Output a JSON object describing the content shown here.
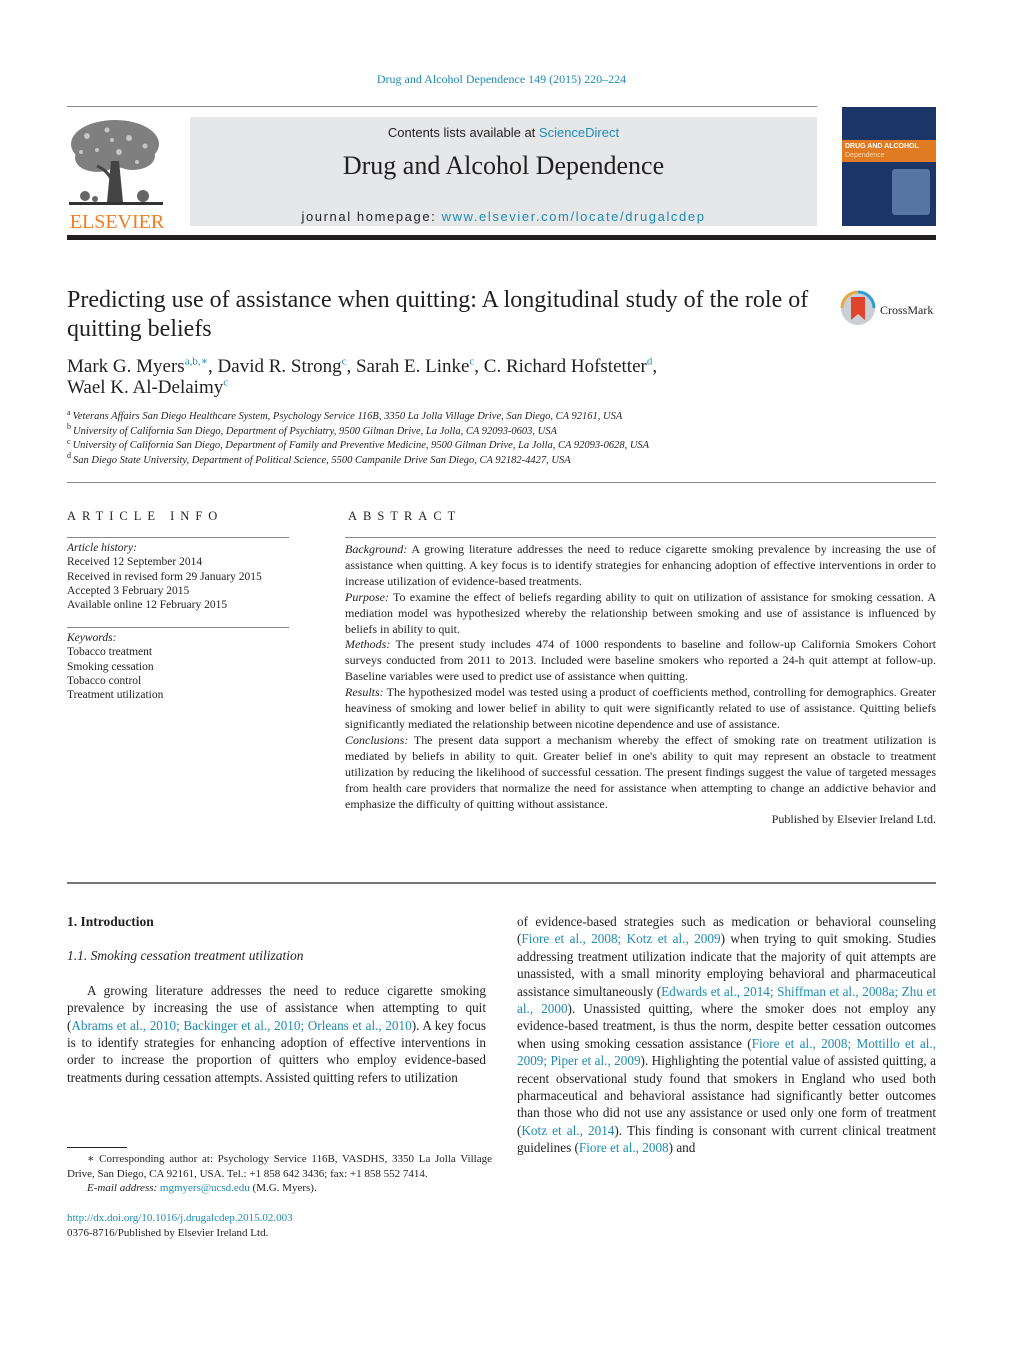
{
  "header": {
    "journal_citation": "Drug and Alcohol Dependence 149 (2015) 220–224",
    "contents_prefix": "Contents lists available at ",
    "contents_link": "ScienceDirect",
    "journal_name": "Drug and Alcohol Dependence",
    "homepage_prefix": "journal homepage: ",
    "homepage_link": "www.elsevier.com/locate/drugalcdep",
    "publisher_logo_text": "ELSEVIER",
    "cover_title": "DRUG AND ALCOHOL",
    "cover_subtitle": "Dependence",
    "colors": {
      "link": "#1f8bb4",
      "elsevier_orange": "#f47b20",
      "masthead_bg": "#e6e7e8"
    }
  },
  "article": {
    "title": "Predicting use of assistance when quitting: A longitudinal study of the role of quitting beliefs",
    "crossmark_label": "CrossMark",
    "authors": [
      {
        "name": "Mark G. Myers",
        "sup": "a,b,∗",
        "sep": ", "
      },
      {
        "name": "David R. Strong",
        "sup": "c",
        "sep": ", "
      },
      {
        "name": "Sarah E. Linke",
        "sup": "c",
        "sep": ", "
      },
      {
        "name": "C. Richard Hofstetter",
        "sup": "d",
        "sep": ","
      },
      {
        "name": "Wael K. Al-Delaimy",
        "sup": "c",
        "sep": ""
      }
    ],
    "affiliations": [
      {
        "key": "a",
        "text": "Veterans Affairs San Diego Healthcare System, Psychology Service 116B, 3350 La Jolla Village Drive, San Diego, CA 92161, USA"
      },
      {
        "key": "b",
        "text": "University of California San Diego, Department of Psychiatry, 9500 Gilman Drive, La Jolla, CA 92093-0603, USA"
      },
      {
        "key": "c",
        "text": "University of California San Diego, Department of Family and Preventive Medicine, 9500 Gilman Drive, La Jolla, CA 92093-0628, USA"
      },
      {
        "key": "d",
        "text": "San Diego State University, Department of Political Science, 5500 Campanile Drive San Diego, CA 92182-4427, USA"
      }
    ]
  },
  "article_info": {
    "heading": "ARTICLE INFO",
    "history_label": "Article history:",
    "history": [
      "Received 12 September 2014",
      "Received in revised form 29 January 2015",
      "Accepted 3 February 2015",
      "Available online 12 February 2015"
    ],
    "keywords_label": "Keywords:",
    "keywords": [
      "Tobacco treatment",
      "Smoking cessation",
      "Tobacco control",
      "Treatment utilization"
    ]
  },
  "abstract": {
    "heading": "ABSTRACT",
    "sections": [
      {
        "label": "Background:",
        "text": " A growing literature addresses the need to reduce cigarette smoking prevalence by increasing the use of assistance when quitting. A key focus is to identify strategies for enhancing adoption of effective interventions in order to increase utilization of evidence-based treatments."
      },
      {
        "label": "Purpose:",
        "text": " To examine the effect of beliefs regarding ability to quit on utilization of assistance for smoking cessation. A mediation model was hypothesized whereby the relationship between smoking and use of assistance is influenced by beliefs in ability to quit."
      },
      {
        "label": "Methods:",
        "text": " The present study includes 474 of 1000 respondents to baseline and follow-up California Smokers Cohort surveys conducted from 2011 to 2013. Included were baseline smokers who reported a 24-h quit attempt at follow-up. Baseline variables were used to predict use of assistance when quitting."
      },
      {
        "label": "Results:",
        "text": " The hypothesized model was tested using a product of coefficients method, controlling for demographics. Greater heaviness of smoking and lower belief in ability to quit were significantly related to use of assistance. Quitting beliefs significantly mediated the relationship between nicotine dependence and use of assistance."
      },
      {
        "label": "Conclusions:",
        "text": " The present data support a mechanism whereby the effect of smoking rate on treatment utilization is mediated by beliefs in ability to quit. Greater belief in one's ability to quit may represent an obstacle to treatment utilization by reducing the likelihood of successful cessation. The present findings suggest the value of targeted messages from health care providers that normalize the need for assistance when attempting to change an addictive behavior and emphasize the difficulty of quitting without assistance."
      }
    ],
    "publisher_line": "Published by Elsevier Ireland Ltd."
  },
  "body": {
    "section_heading": "1.  Introduction",
    "subsection_heading": "1.1.  Smoking cessation treatment utilization",
    "left_paragraph": [
      {
        "t": "A growing literature addresses the need to reduce cigarette smoking prevalence by increasing the use of assistance when attempting to quit ("
      },
      {
        "c": "Abrams et al., 2010; Backinger et al., 2010; Orleans et al., 2010"
      },
      {
        "t": "). A key focus is to identify strategies for enhancing adoption of effective interventions in order to increase the proportion of quitters who employ evidence-based treatments during cessation attempts. Assisted quitting refers to utilization"
      }
    ],
    "right_paragraph": [
      {
        "t": "of evidence-based strategies such as medication or behavioral counseling ("
      },
      {
        "c": "Fiore et al., 2008; Kotz et al., 2009"
      },
      {
        "t": ") when trying to quit smoking. Studies addressing treatment utilization indicate that the majority of quit attempts are unassisted, with a small minority employing behavioral and pharmaceutical assistance simultaneously ("
      },
      {
        "c": "Edwards et al., 2014; Shiffman et al., 2008a; Zhu et al., 2000"
      },
      {
        "t": "). Unassisted quitting, where the smoker does not employ any evidence-based treatment, is thus the norm, despite better cessation outcomes when using smoking cessation assistance ("
      },
      {
        "c": "Fiore et al., 2008; Mottillo et al., 2009; Piper et al., 2009"
      },
      {
        "t": "). Highlighting the potential value of assisted quitting, a recent observational study found that smokers in England who used both pharmaceutical and behavioral assistance had significantly better outcomes than those who did not use any assistance or used only one form of treatment ("
      },
      {
        "c": "Kotz et al., 2014"
      },
      {
        "t": "). This finding is consonant with current clinical treatment guidelines ("
      },
      {
        "c": "Fiore et al., 2008"
      },
      {
        "t": ") and"
      }
    ]
  },
  "footnote": {
    "corresponding": "∗ Corresponding author at: Psychology Service 116B, VASDHS, 3350 La Jolla Village Drive, San Diego, CA 92161, USA. Tel.: +1 858 642 3436; fax: +1 858 552 7414.",
    "email_label": "E-mail address:",
    "email": "mgmyers@ucsd.edu",
    "email_suffix": " (M.G. Myers).",
    "doi": "http://dx.doi.org/10.1016/j.drugalcdep.2015.02.003",
    "issn_line": "0376-8716/Published by Elsevier Ireland Ltd."
  }
}
